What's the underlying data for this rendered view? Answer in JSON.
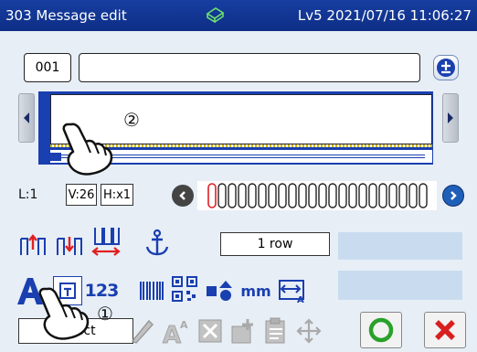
{
  "titlebar": {
    "title": "303 Message edit",
    "status": "Lv5 2021/07/16 11:06:27"
  },
  "editor": {
    "message_number": "001",
    "callout_1": "①",
    "callout_2": "②"
  },
  "info": {
    "line": "L:1",
    "v_size": "V:26",
    "h_size": "H:x1"
  },
  "row_control": {
    "rows": "1 row"
  },
  "toolbar": {
    "select_label": "Select"
  },
  "colors": {
    "accent": "#1a3fb0",
    "ok": "#2aa12a",
    "cancel": "#d82020",
    "cursor": "#e02020"
  }
}
